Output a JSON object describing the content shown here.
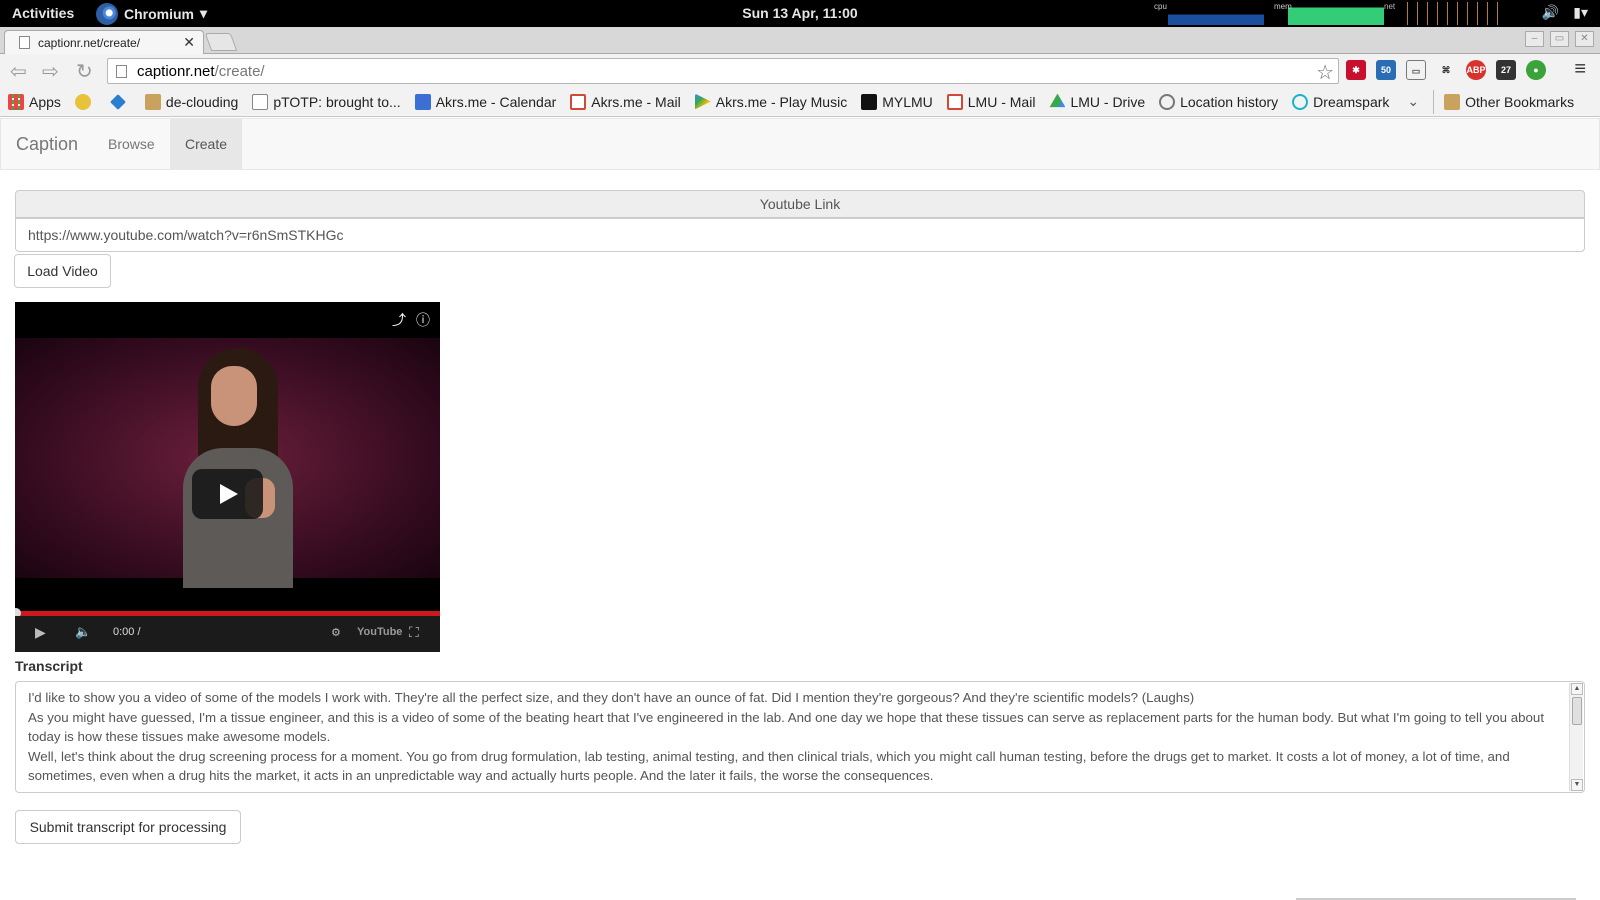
{
  "system_bar": {
    "activities": "Activities",
    "app_name": "Chromium",
    "clock": "Sun 13 Apr, 11:00",
    "monitor_labels": {
      "cpu": "cpu",
      "mem": "mem",
      "net": "net"
    }
  },
  "browser": {
    "tab_title": "captionr.net/create/",
    "url_host": "captionr.net",
    "url_path": "/create/",
    "extension_badges": {
      "first": "50",
      "second": "27"
    },
    "bookmarks": [
      "Apps",
      "de-clouding",
      "pTOTP: brought to...",
      "Akrs.me - Calendar",
      "Akrs.me - Mail",
      "Akrs.me - Play Music",
      "MYLMU",
      "LMU - Mail",
      "LMU - Drive",
      "Location history",
      "Dreamspark"
    ],
    "other_bookmarks": "Other Bookmarks"
  },
  "navbar": {
    "brand": "Caption",
    "links": [
      "Browse",
      "Create"
    ],
    "active": "Create"
  },
  "form": {
    "youtube_label": "Youtube Link",
    "youtube_url": "https://www.youtube.com/watch?v=r6nSmSTKHGc",
    "load_button": "Load Video",
    "video_time": "0:00 /",
    "youtube_logo": "YouTube",
    "transcript_label": "Transcript",
    "transcript_lines": [
      "I'd like to show you a video of some of the models I work with. They're all the perfect size, and they don't have an ounce of fat. Did I mention they're gorgeous? And they're scientific models? (Laughs)",
      "As you might have guessed, I'm a tissue engineer, and this is a video of some of the beating heart that I've engineered in the lab. And one day we hope that these tissues can serve as replacement parts for the human body. But what I'm going to tell you about today is how these tissues make awesome models.",
      "Well, let's think about the drug screening process for a moment. You go from drug formulation, lab testing, animal testing, and then clinical trials, which you might call human testing, before the drugs get to market. It costs a lot of money, a lot of time, and sometimes, even when a drug hits the market, it acts in an unpredictable way and actually hurts people. And the later it fails, the worse the consequences."
    ],
    "submit_button": "Submit transcript for processing"
  }
}
